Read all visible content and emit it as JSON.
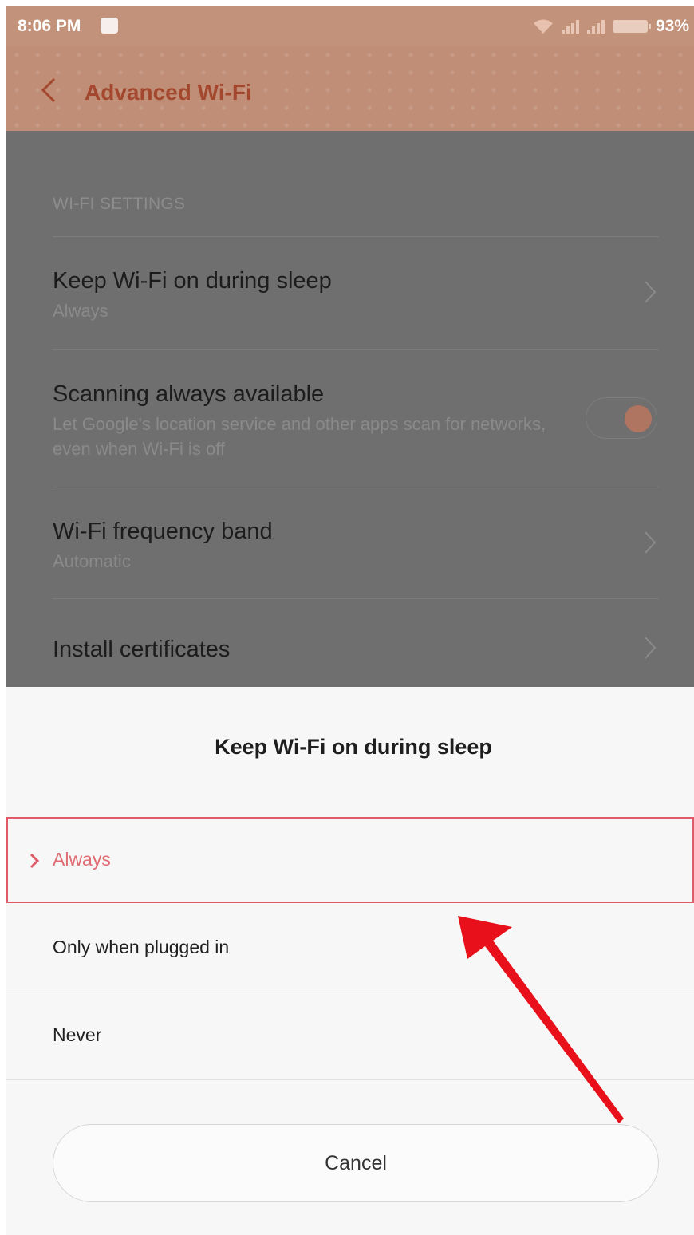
{
  "status_bar": {
    "time": "8:06 PM",
    "battery": "93%"
  },
  "header": {
    "title": "Advanced Wi-Fi"
  },
  "settings": {
    "section_label": "WI-FI SETTINGS",
    "items": [
      {
        "title": "Keep Wi-Fi on during sleep",
        "subtitle": "Always"
      },
      {
        "title": "Scanning always available",
        "subtitle": "Let Google's location service and other apps scan for networks, even when Wi-Fi is off",
        "toggle_on": true
      },
      {
        "title": "Wi-Fi frequency band",
        "subtitle": "Automatic"
      },
      {
        "title": "Install certificates"
      }
    ]
  },
  "dialog": {
    "title": "Keep Wi-Fi on during sleep",
    "options": [
      {
        "label": "Always",
        "selected": true
      },
      {
        "label": "Only when plugged in",
        "selected": false
      },
      {
        "label": "Never",
        "selected": false
      }
    ],
    "cancel_label": "Cancel"
  },
  "colors": {
    "accent": "#e05b68",
    "header_title": "#a3482e",
    "annotation_arrow": "#e8101a"
  }
}
